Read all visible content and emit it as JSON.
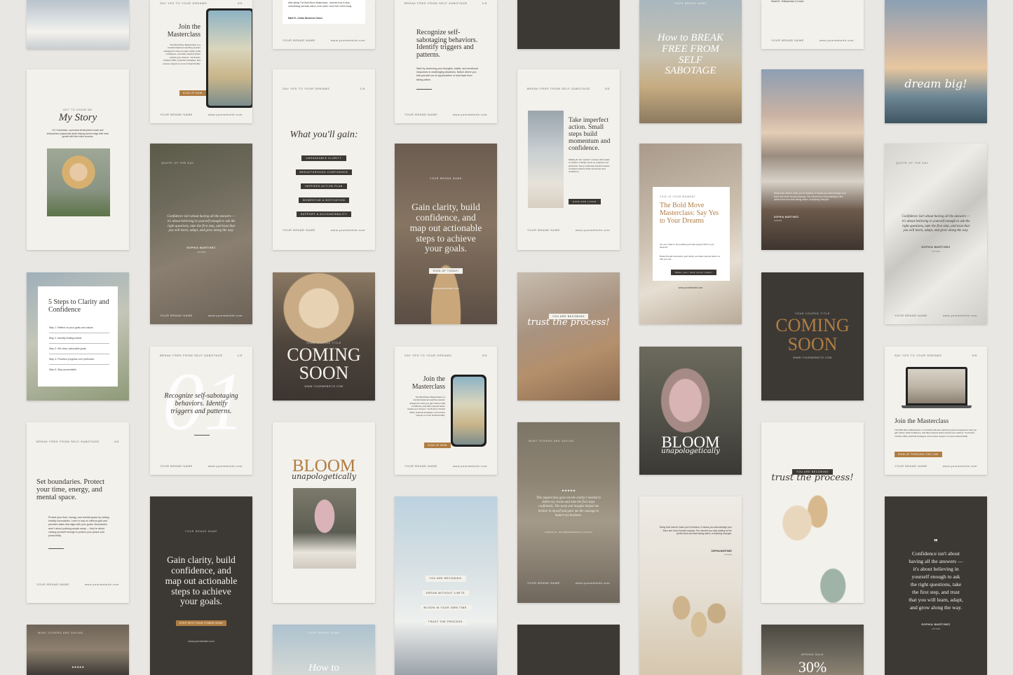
{
  "brand": "YOUR BRAND NAME",
  "website": "www.yourwebsite.com",
  "website_caps": "WWW.YOURWEBSITE.COM",
  "colors": {
    "background": "#e9e7e3",
    "cream": "#f3f1ec",
    "dark": "#3c3935",
    "gold": "#b07d43"
  },
  "texts": {
    "say_yes": "SAY YES TO YOUR DREAMS",
    "break_free": "BREAK FREE FROM SELF-SABOTAGE",
    "quote_of_day": "QUOTE OF THE DAY",
    "what_others": "WHAT OTHERS ARE SAYING",
    "get_to_know": "GET TO KNOW ME",
    "your_course": "YOUR COURSE TITLE",
    "this_is_moment": "THIS IS YOUR MOMENT",
    "you_are_becoming": "YOU ARE BECOMING",
    "spring_sale": "SPRING SALE"
  },
  "pages": {
    "p1_5": "1/5",
    "p3_5": "3/5",
    "p4_5": "4/5",
    "p5_5": "5/5"
  },
  "cards": {
    "testimonial_top": {
      "text": "After taking The Bold Move Masterclass, I learned how to stop overthinking and take action, even when I don't feel 100% ready.",
      "name": "Mark R., Online Business Owner",
      "sarah": "Sarah M., Entrepreneur & Coach"
    },
    "join_masterclass": {
      "title": "Join the Masterclass",
      "body": "The Bold Move Masterclass is a transformational coaching session designed to help you gain clarity, build confidence, and take inspired action toward your dreams. You'll learn mindset shifts, practical strategies, and receive support to move forward boldly.",
      "cta": "Sign up now"
    },
    "recognize": {
      "title": "Recognize self-sabotaging behaviors. Identify triggers and patterns.",
      "body": "Start by observing your thoughts, habits, and emotional responses in challenging situations. Notice where you talk yourself out of opportunities or hold back from taking action."
    },
    "how_to": {
      "title": "How to BREAK FREE FROM SELF SABOTAGE"
    },
    "my_story": {
      "title": "My Story",
      "body": "Hi, I'm Amanda, a personal development coach and entrepreneur passionate about helping women align their inner growth with their outer success."
    },
    "quote_card": {
      "text": "Confidence isn't about having all the answers — it's about believing in yourself enough to ask the right questions, take the first step, and trust that you will learn, adapt, and grow along the way.",
      "name": "SOPHIA MARTINEZ",
      "role": "AUTHOR"
    },
    "gain": {
      "title": "What you'll gain:",
      "items": [
        "UNSHAKABLE CLARITY",
        "BREAKTHROUGH CONFIDENCE",
        "INSPIRED ACTION PLAN",
        "MOMENTUM & MOTIVATION",
        "SUPPORT & ACCOUNTABILITY"
      ]
    },
    "gain_clarity": {
      "line1": "Gain clarity, build",
      "line2": "confidence, and",
      "line3": "map out actionable",
      "line4": "steps to achieve",
      "line5": "your goals.",
      "cta": "SIGN UP TODAY!",
      "cta2": "STEP INTO YOUR POWER NOW!"
    },
    "imperfect": {
      "title": "Take imperfect action. Small steps build momentum and confidence.",
      "body": "Waiting for the \"perfect\" moment often leads to inaction. Instead, focus on progress over perfection. Every small step forward creates consistent actions build momentum and confidence.",
      "cta": "SAVE FOR LATER"
    },
    "bold_move": {
      "title": "The Bold Move Masterclass: Say Yes to Your Dreams",
      "body1": "Are you ready to stop waiting and start saying YES to your dreams?",
      "body2": "Break through self-doubt, gain clarity, and take inspired action so that you can...",
      "cta": "Make your bold move today!"
    },
    "sea_quote": {
      "text": "Being bold doesn't mean you're fearless, it means you acknowledge your fears and move forward anyway. The moment you stop waiting for the perfect time and start taking action, everything changes.",
      "name": "SOPHIA MARTINEZ",
      "role": "AUTHOR"
    },
    "dream_big": "dream big!",
    "steps": {
      "title": "5 Steps to Clarity and Confidence",
      "items": [
        "Step 1: Reflect on your goals and values",
        "Step 2: Identify limiting beliefs",
        "Step 3: Set clear, actionable goals",
        "Step 4: Prioritize progress over perfection",
        "Step 5: Stay accountable"
      ]
    },
    "coming_soon": {
      "l1": "COMING",
      "l2": "SOON"
    },
    "trust": "trust the process!",
    "number_01": "01",
    "join2": {
      "title": "Join the Masterclass",
      "body": "The Bold Move Masterclass is a transformational coaching session designed to help you gain clarity, build confidence, and take inspired action toward your dreams. You'll learn mindset shifts, practical strategies, and receive support to move forward boldly.",
      "cta": "Sign up now"
    },
    "join3": {
      "cta": "Sign up through the link"
    },
    "boundaries": {
      "title": "Set boundaries. Protect your time, energy, and mental space.",
      "body": "Protect your time, energy, and mental space by setting healthy boundaries. Learn to say no without guilt and prioritize tasks that align with your goals. Boundaries aren't about pushing people away — they're about valuing yourself enough to protect your peace and productivity."
    },
    "bloom": {
      "l1": "BLOOM",
      "l2": "unapologetically"
    },
    "affirm": [
      "YOU ARE BECOMING.",
      "DREAM WITHOUT LIMITS.",
      "BLOOM IN YOUR OWN TIME.",
      "TRUST THE PROCESS."
    ],
    "masterclass_quote": {
      "text": "This masterclass gave me the clarity I needed to define my vision and take the first steps confidently. The tools and insights helped me believe in myself and gave me the courage to launch my business.",
      "name": "SARAH W., ENTREPRENEUR & COACH",
      "stars": "★★★★★"
    },
    "dark_quote": {
      "mark": "❞",
      "text": "Confidence isn't about having all the answers — it's about believing in yourself enough to ask the right questions, take the first step, and trust that you will learn, adapt, and grow along the way.",
      "name": "SOPHIA MARTINEZ",
      "role": "AUTHOR"
    },
    "how_to_short": "How to",
    "sale": "30%"
  }
}
